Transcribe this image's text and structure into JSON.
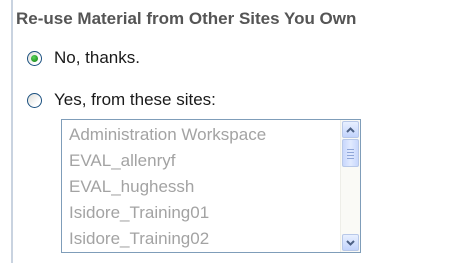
{
  "section": {
    "heading": "Re-use Material from Other Sites You Own"
  },
  "options": {
    "no": {
      "label": "No, thanks.",
      "selected": true
    },
    "yes": {
      "label": "Yes, from these sites:",
      "selected": false
    }
  },
  "sites_list": {
    "disabled": true,
    "items": [
      "Administration Workspace",
      "EVAL_allenryf",
      "EVAL_hughessh",
      "Isidore_Training01",
      "Isidore_Training02"
    ]
  },
  "colors": {
    "heading": "#555555",
    "radio_selected": "#2ea32e",
    "list_text_disabled": "#a3a3a3",
    "listbox_border": "#7f9db9",
    "left_border": "#c9d3e0"
  },
  "icons": {
    "scroll_up": "chevron-up-icon",
    "scroll_down": "chevron-down-icon"
  }
}
